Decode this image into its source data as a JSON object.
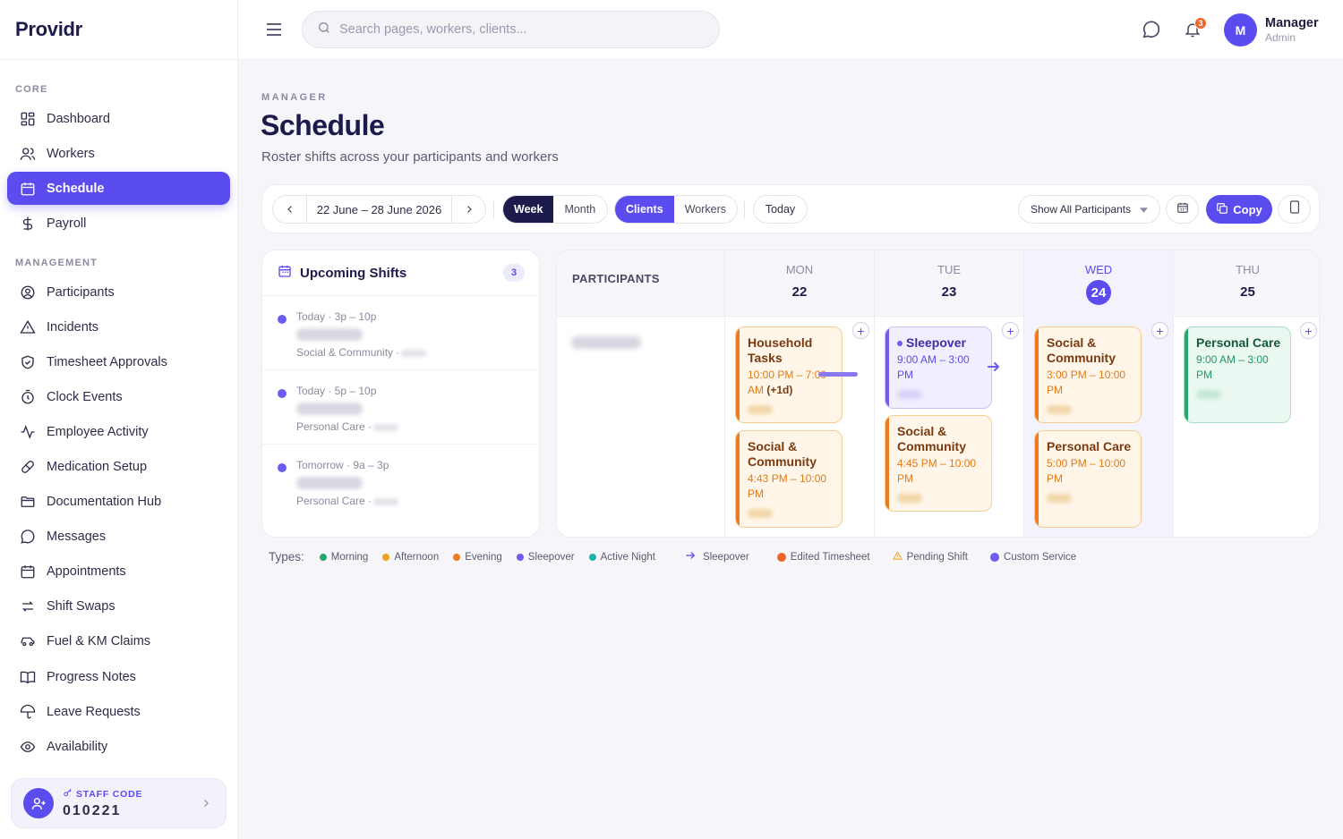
{
  "app": {
    "brand": "Providr"
  },
  "sidebar": {
    "sections": [
      "CORE",
      "MANAGEMENT"
    ],
    "items": [
      {
        "label": "Dashboard",
        "icon": "dashboard-icon",
        "active": false
      },
      {
        "label": "Workers",
        "icon": "users-icon",
        "active": false
      },
      {
        "label": "Schedule",
        "icon": "calendar-icon",
        "active": true
      },
      {
        "label": "Payroll",
        "icon": "dollar-icon",
        "active": false
      },
      {
        "label": "Participants",
        "icon": "user-circle-icon",
        "active": false
      },
      {
        "label": "Incidents",
        "icon": "warning-icon",
        "active": false
      },
      {
        "label": "Timesheet Approvals",
        "icon": "shield-check-icon",
        "active": false
      },
      {
        "label": "Clock Events",
        "icon": "timer-icon",
        "active": false
      },
      {
        "label": "Employee Activity",
        "icon": "activity-icon",
        "active": false
      },
      {
        "label": "Medication Setup",
        "icon": "pill-icon",
        "active": false
      },
      {
        "label": "Documentation Hub",
        "icon": "folder-icon",
        "active": false
      },
      {
        "label": "Messages",
        "icon": "message-icon",
        "active": false
      },
      {
        "label": "Appointments",
        "icon": "calendar-icon",
        "active": false
      },
      {
        "label": "Shift Swaps",
        "icon": "swap-icon",
        "active": false
      },
      {
        "label": "Fuel & KM Claims",
        "icon": "car-icon",
        "active": false
      },
      {
        "label": "Progress Notes",
        "icon": "book-icon",
        "active": false
      },
      {
        "label": "Leave Requests",
        "icon": "umbrella-icon",
        "active": false
      },
      {
        "label": "Availability",
        "icon": "eye-icon",
        "active": false
      }
    ],
    "staff": {
      "label": "STAFF CODE",
      "code": "010221"
    }
  },
  "header": {
    "search_placeholder": "Search pages, workers, clients...",
    "notifications_count": "3",
    "user": {
      "initial": "M",
      "name": "Manager",
      "role": "Admin"
    }
  },
  "page": {
    "eyebrow": "MANAGER",
    "title": "Schedule",
    "subtitle": "Roster shifts across your participants and workers"
  },
  "toolbar": {
    "date_range": "22 June – 28 June 2026",
    "view_week": "Week",
    "view_month": "Month",
    "mode_clients": "Clients",
    "mode_workers": "Workers",
    "today": "Today",
    "filter": "Show All Participants",
    "copy": "Copy"
  },
  "upcoming": {
    "title": "Upcoming Shifts",
    "count": "3",
    "items": [
      {
        "time": "Today · 3p – 10p",
        "service": "Social & Community ·"
      },
      {
        "time": "Today · 5p – 10p",
        "service": "Personal Care ·"
      },
      {
        "time": "Tomorrow · 9a – 3p",
        "service": "Personal Care ·"
      }
    ]
  },
  "calendar": {
    "participants_label": "PARTICIPANTS",
    "days": [
      {
        "name": "MON",
        "num": "22"
      },
      {
        "name": "TUE",
        "num": "23"
      },
      {
        "name": "WED",
        "num": "24",
        "today": true
      },
      {
        "name": "THU",
        "num": "25"
      }
    ],
    "shifts": {
      "mon1": {
        "title": "Household Tasks",
        "time": "10:00 PM – 7:00 AM",
        "suffix": "(+1d)"
      },
      "mon2": {
        "title": "Social & Community",
        "time": "4:43 PM – 10:00 PM"
      },
      "tue1": {
        "title": "Sleepover",
        "time": "9:00 AM – 3:00 PM"
      },
      "tue2": {
        "title": "Social & Community",
        "time": "4:45 PM – 10:00 PM"
      },
      "wed1": {
        "title": "Social & Community",
        "time": "3:00 PM – 10:00 PM"
      },
      "wed2": {
        "title": "Personal Care",
        "time": "5:00 PM – 10:00 PM"
      },
      "thu1": {
        "title": "Personal Care",
        "time": "9:00 AM – 3:00 PM"
      }
    }
  },
  "legend": {
    "label": "Types:",
    "items": [
      {
        "label": "Morning",
        "color": "#2aa56f"
      },
      {
        "label": "Afternoon",
        "color": "#f0a020"
      },
      {
        "label": "Evening",
        "color": "#f07a1e"
      },
      {
        "label": "Sleepover",
        "color": "#6c5cf0"
      },
      {
        "label": "Active Night",
        "color": "#22b3b0"
      },
      {
        "label": "Sleepover",
        "color": "#6c5cf0",
        "icon": "sleepover-arrow-icon"
      },
      {
        "label": "Edited Timesheet",
        "color": "#f0642a"
      },
      {
        "label": "Pending Shift",
        "color": "#f0a020",
        "icon": "warning-icon"
      },
      {
        "label": "Custom Service",
        "color": "#6c5cf0"
      }
    ]
  }
}
